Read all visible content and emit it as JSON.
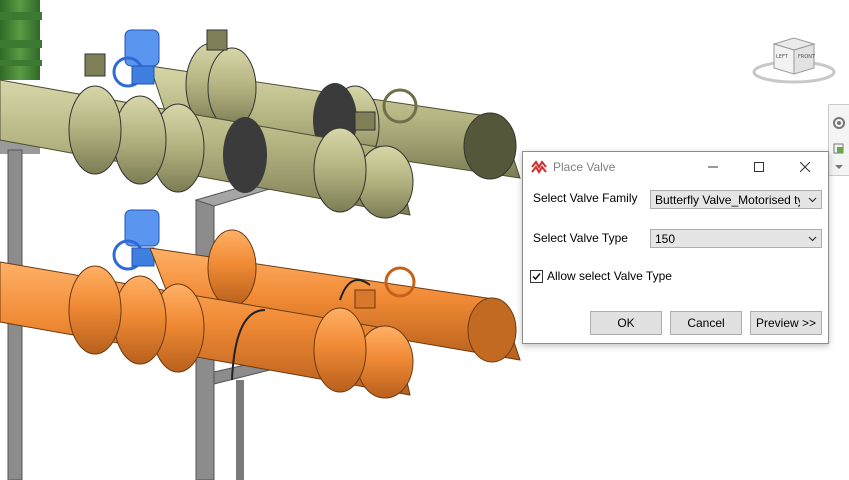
{
  "viewcube": {
    "left_label": "LEFT",
    "front_label": "FRONT"
  },
  "dialog": {
    "title": "Place Valve",
    "fields": {
      "family_label": "Select Valve Family",
      "family_value": "Butterfly Valve_Motorised type_",
      "type_label": "Select Valve Type",
      "type_value": "150",
      "allow_label": "Allow select Valve Type",
      "allow_checked": true
    },
    "buttons": {
      "ok": "OK",
      "cancel": "Cancel",
      "preview": "Preview >>"
    }
  },
  "colors": {
    "olive_pipe": "#b9b98a",
    "orange_pipe": "#f08c3a",
    "actuator_blue": "#3f7fe0",
    "steel": "#8a8a8a",
    "green_pipe": "#4f8a3a"
  },
  "icons": {
    "app": "place-valve-icon",
    "minimize": "minimize-icon",
    "maximize": "maximize-icon",
    "close": "close-icon"
  }
}
